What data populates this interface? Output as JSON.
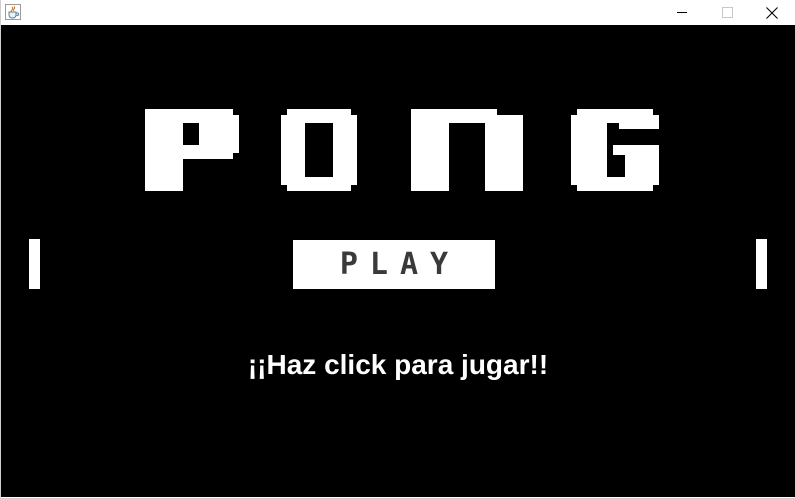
{
  "window": {
    "controls": {
      "minimize_icon": "minimize-icon",
      "maximize_icon": "maximize-icon",
      "close_icon": "close-icon"
    },
    "app_icon": "java-coffee-cup-icon"
  },
  "game": {
    "background_color": "#000000",
    "foreground_color": "#ffffff",
    "title_logo_text": "PONG",
    "play_button_label": "PLAY",
    "prompt": "¡¡Haz click para jugar!!"
  }
}
